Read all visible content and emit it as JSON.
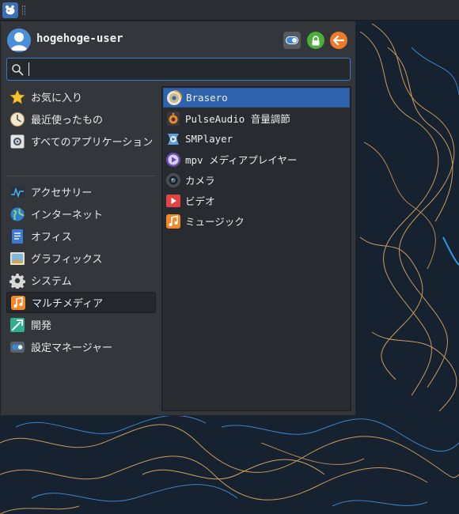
{
  "user": {
    "name": "hogehoge-user"
  },
  "search": {
    "value": "",
    "placeholder": ""
  },
  "categories": [
    {
      "label": "お気に入り",
      "icon": "star-icon"
    },
    {
      "label": "最近使ったもの",
      "icon": "clock-icon"
    },
    {
      "label": "すべてのアプリケーション",
      "icon": "all-apps-icon"
    },
    {
      "label": "アクセサリー",
      "icon": "accessories-icon"
    },
    {
      "label": "インターネット",
      "icon": "globe-icon"
    },
    {
      "label": "オフィス",
      "icon": "office-icon"
    },
    {
      "label": "グラフィックス",
      "icon": "graphics-icon"
    },
    {
      "label": "システム",
      "icon": "system-gear-icon"
    },
    {
      "label": "マルチメディア",
      "icon": "multimedia-icon",
      "active": true
    },
    {
      "label": "開発",
      "icon": "development-icon"
    },
    {
      "label": "設定マネージャー",
      "icon": "settings-manager-icon"
    }
  ],
  "apps": [
    {
      "label": "Brasero",
      "icon": "brasero-icon",
      "selected": true
    },
    {
      "label": "PulseAudio 音量調節",
      "icon": "speaker-icon"
    },
    {
      "label": "SMPlayer",
      "icon": "smplayer-icon"
    },
    {
      "label": "mpv メディアプレイヤー",
      "icon": "mpv-icon"
    },
    {
      "label": "カメラ",
      "icon": "camera-icon"
    },
    {
      "label": "ビデオ",
      "icon": "video-icon"
    },
    {
      "label": "ミュージック",
      "icon": "music-icon"
    }
  ],
  "colors": {
    "accent": "#2f63ad",
    "menu_background": "#33373c",
    "panel_background": "#2b2e33",
    "lock": "#4caf3a",
    "logout": "#f07a2a"
  }
}
